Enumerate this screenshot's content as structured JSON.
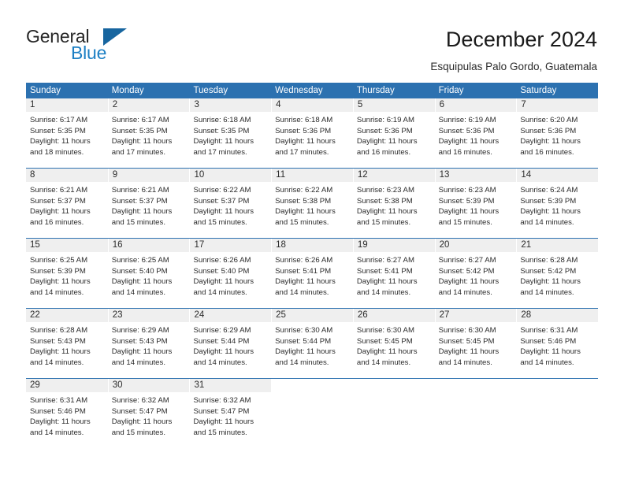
{
  "logo": {
    "word1": "General",
    "word2": "Blue",
    "triangle_icon": "triangle-icon",
    "color_dark": "#262626",
    "color_blue": "#1c7fc4",
    "color_triangle": "#17659f"
  },
  "header": {
    "title": "December 2024",
    "subtitle": "Esquipulas Palo Gordo, Guatemala"
  },
  "colors": {
    "header_blue": "#2c71b0",
    "daynum_band": "#efefef",
    "text": "#2b2b2b"
  },
  "calendar": {
    "day_names": [
      "Sunday",
      "Monday",
      "Tuesday",
      "Wednesday",
      "Thursday",
      "Friday",
      "Saturday"
    ],
    "weeks": [
      [
        {
          "day": "1",
          "sunrise": "Sunrise: 6:17 AM",
          "sunset": "Sunset: 5:35 PM",
          "daylight": "Daylight: 11 hours and 18 minutes."
        },
        {
          "day": "2",
          "sunrise": "Sunrise: 6:17 AM",
          "sunset": "Sunset: 5:35 PM",
          "daylight": "Daylight: 11 hours and 17 minutes."
        },
        {
          "day": "3",
          "sunrise": "Sunrise: 6:18 AM",
          "sunset": "Sunset: 5:35 PM",
          "daylight": "Daylight: 11 hours and 17 minutes."
        },
        {
          "day": "4",
          "sunrise": "Sunrise: 6:18 AM",
          "sunset": "Sunset: 5:36 PM",
          "daylight": "Daylight: 11 hours and 17 minutes."
        },
        {
          "day": "5",
          "sunrise": "Sunrise: 6:19 AM",
          "sunset": "Sunset: 5:36 PM",
          "daylight": "Daylight: 11 hours and 16 minutes."
        },
        {
          "day": "6",
          "sunrise": "Sunrise: 6:19 AM",
          "sunset": "Sunset: 5:36 PM",
          "daylight": "Daylight: 11 hours and 16 minutes."
        },
        {
          "day": "7",
          "sunrise": "Sunrise: 6:20 AM",
          "sunset": "Sunset: 5:36 PM",
          "daylight": "Daylight: 11 hours and 16 minutes."
        }
      ],
      [
        {
          "day": "8",
          "sunrise": "Sunrise: 6:21 AM",
          "sunset": "Sunset: 5:37 PM",
          "daylight": "Daylight: 11 hours and 16 minutes."
        },
        {
          "day": "9",
          "sunrise": "Sunrise: 6:21 AM",
          "sunset": "Sunset: 5:37 PM",
          "daylight": "Daylight: 11 hours and 15 minutes."
        },
        {
          "day": "10",
          "sunrise": "Sunrise: 6:22 AM",
          "sunset": "Sunset: 5:37 PM",
          "daylight": "Daylight: 11 hours and 15 minutes."
        },
        {
          "day": "11",
          "sunrise": "Sunrise: 6:22 AM",
          "sunset": "Sunset: 5:38 PM",
          "daylight": "Daylight: 11 hours and 15 minutes."
        },
        {
          "day": "12",
          "sunrise": "Sunrise: 6:23 AM",
          "sunset": "Sunset: 5:38 PM",
          "daylight": "Daylight: 11 hours and 15 minutes."
        },
        {
          "day": "13",
          "sunrise": "Sunrise: 6:23 AM",
          "sunset": "Sunset: 5:39 PM",
          "daylight": "Daylight: 11 hours and 15 minutes."
        },
        {
          "day": "14",
          "sunrise": "Sunrise: 6:24 AM",
          "sunset": "Sunset: 5:39 PM",
          "daylight": "Daylight: 11 hours and 14 minutes."
        }
      ],
      [
        {
          "day": "15",
          "sunrise": "Sunrise: 6:25 AM",
          "sunset": "Sunset: 5:39 PM",
          "daylight": "Daylight: 11 hours and 14 minutes."
        },
        {
          "day": "16",
          "sunrise": "Sunrise: 6:25 AM",
          "sunset": "Sunset: 5:40 PM",
          "daylight": "Daylight: 11 hours and 14 minutes."
        },
        {
          "day": "17",
          "sunrise": "Sunrise: 6:26 AM",
          "sunset": "Sunset: 5:40 PM",
          "daylight": "Daylight: 11 hours and 14 minutes."
        },
        {
          "day": "18",
          "sunrise": "Sunrise: 6:26 AM",
          "sunset": "Sunset: 5:41 PM",
          "daylight": "Daylight: 11 hours and 14 minutes."
        },
        {
          "day": "19",
          "sunrise": "Sunrise: 6:27 AM",
          "sunset": "Sunset: 5:41 PM",
          "daylight": "Daylight: 11 hours and 14 minutes."
        },
        {
          "day": "20",
          "sunrise": "Sunrise: 6:27 AM",
          "sunset": "Sunset: 5:42 PM",
          "daylight": "Daylight: 11 hours and 14 minutes."
        },
        {
          "day": "21",
          "sunrise": "Sunrise: 6:28 AM",
          "sunset": "Sunset: 5:42 PM",
          "daylight": "Daylight: 11 hours and 14 minutes."
        }
      ],
      [
        {
          "day": "22",
          "sunrise": "Sunrise: 6:28 AM",
          "sunset": "Sunset: 5:43 PM",
          "daylight": "Daylight: 11 hours and 14 minutes."
        },
        {
          "day": "23",
          "sunrise": "Sunrise: 6:29 AM",
          "sunset": "Sunset: 5:43 PM",
          "daylight": "Daylight: 11 hours and 14 minutes."
        },
        {
          "day": "24",
          "sunrise": "Sunrise: 6:29 AM",
          "sunset": "Sunset: 5:44 PM",
          "daylight": "Daylight: 11 hours and 14 minutes."
        },
        {
          "day": "25",
          "sunrise": "Sunrise: 6:30 AM",
          "sunset": "Sunset: 5:44 PM",
          "daylight": "Daylight: 11 hours and 14 minutes."
        },
        {
          "day": "26",
          "sunrise": "Sunrise: 6:30 AM",
          "sunset": "Sunset: 5:45 PM",
          "daylight": "Daylight: 11 hours and 14 minutes."
        },
        {
          "day": "27",
          "sunrise": "Sunrise: 6:30 AM",
          "sunset": "Sunset: 5:45 PM",
          "daylight": "Daylight: 11 hours and 14 minutes."
        },
        {
          "day": "28",
          "sunrise": "Sunrise: 6:31 AM",
          "sunset": "Sunset: 5:46 PM",
          "daylight": "Daylight: 11 hours and 14 minutes."
        }
      ],
      [
        {
          "day": "29",
          "sunrise": "Sunrise: 6:31 AM",
          "sunset": "Sunset: 5:46 PM",
          "daylight": "Daylight: 11 hours and 14 minutes."
        },
        {
          "day": "30",
          "sunrise": "Sunrise: 6:32 AM",
          "sunset": "Sunset: 5:47 PM",
          "daylight": "Daylight: 11 hours and 15 minutes."
        },
        {
          "day": "31",
          "sunrise": "Sunrise: 6:32 AM",
          "sunset": "Sunset: 5:47 PM",
          "daylight": "Daylight: 11 hours and 15 minutes."
        },
        {
          "day": "",
          "sunrise": "",
          "sunset": "",
          "daylight": ""
        },
        {
          "day": "",
          "sunrise": "",
          "sunset": "",
          "daylight": ""
        },
        {
          "day": "",
          "sunrise": "",
          "sunset": "",
          "daylight": ""
        },
        {
          "day": "",
          "sunrise": "",
          "sunset": "",
          "daylight": ""
        }
      ]
    ]
  }
}
